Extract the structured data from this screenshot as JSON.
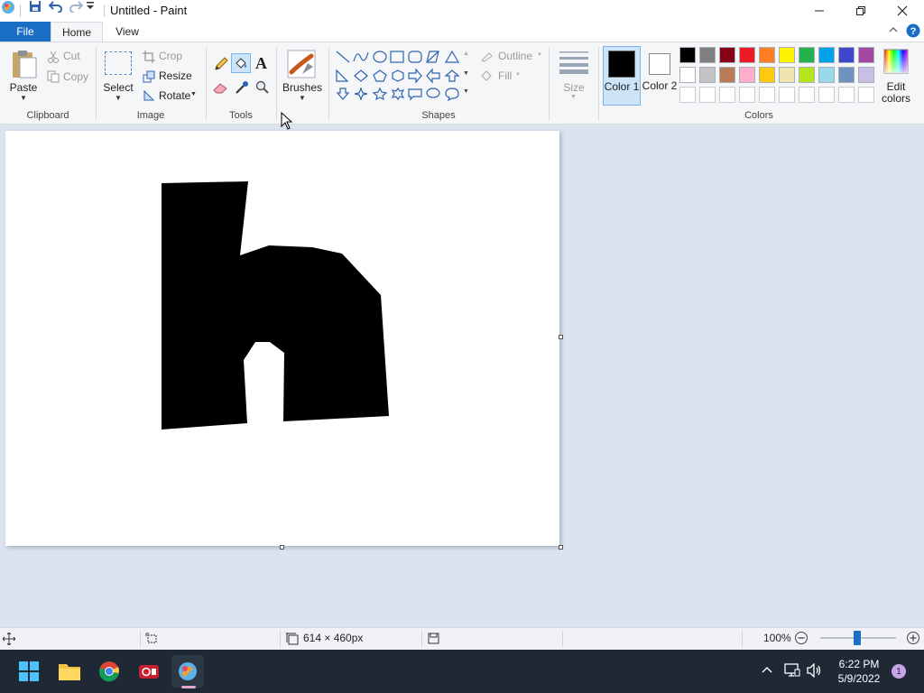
{
  "window": {
    "title": "Untitled - Paint"
  },
  "tabs": {
    "file": "File",
    "home": "Home",
    "view": "View"
  },
  "clipboard": {
    "paste": "Paste",
    "cut": "Cut",
    "copy": "Copy",
    "group": "Clipboard"
  },
  "image": {
    "select": "Select",
    "crop": "Crop",
    "resize": "Resize",
    "rotate": "Rotate",
    "group": "Image"
  },
  "tools": {
    "group": "Tools"
  },
  "brushes": {
    "label": "Brushes"
  },
  "shapes": {
    "outline": "Outline",
    "fill": "Fill",
    "group": "Shapes"
  },
  "size": {
    "label": "Size"
  },
  "colors": {
    "color1": "Color 1",
    "color2": "Color 2",
    "edit": "Edit colors",
    "group": "Colors",
    "color1_value": "#000000",
    "color2_value": "#ffffff",
    "palette_row1": [
      "#000000",
      "#7f7f7f",
      "#880015",
      "#ed1c24",
      "#ff7f27",
      "#fff200",
      "#22b14c",
      "#00a2e8",
      "#3f48cc",
      "#a349a4"
    ],
    "palette_row2": [
      "#ffffff",
      "#c3c3c3",
      "#b97a57",
      "#ffaec9",
      "#ffc90e",
      "#efe4b0",
      "#b5e61d",
      "#99d9ea",
      "#7092be",
      "#c8bfe7"
    ],
    "palette_row3": [
      "#ffffff",
      "#ffffff",
      "#ffffff",
      "#ffffff",
      "#ffffff",
      "#ffffff",
      "#ffffff",
      "#ffffff",
      "#ffffff",
      "#ffffff"
    ]
  },
  "status": {
    "dimensions": "614 × 460px",
    "zoom": "100%",
    "zoom_value": 1.0
  },
  "taskbar": {
    "time": "6:22 PM",
    "date": "5/9/2022",
    "notifications": "1"
  }
}
